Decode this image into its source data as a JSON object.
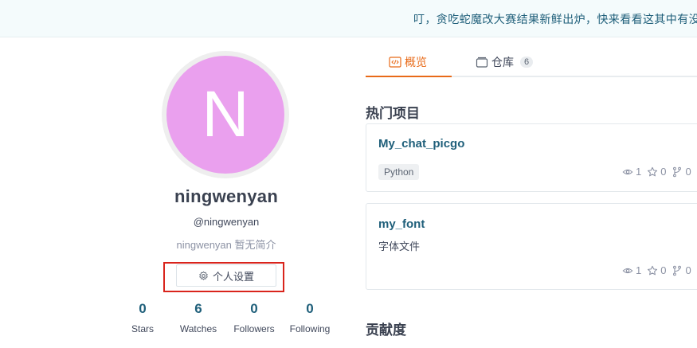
{
  "banner": {
    "text": "叮，贪吃蛇魔改大赛结果新鲜出炉，快来看看这其中有没有"
  },
  "profile": {
    "avatar_letter": "N",
    "avatar_color": "#eaa0ee",
    "display_name": "ningwenyan",
    "handle": "@ningwenyan",
    "bio": "ningwenyan 暂无简介",
    "settings_label": "个人设置"
  },
  "stats": [
    {
      "value": "0",
      "label": "Stars"
    },
    {
      "value": "6",
      "label": "Watches"
    },
    {
      "value": "0",
      "label": "Followers"
    },
    {
      "value": "0",
      "label": "Following"
    }
  ],
  "tabs": {
    "overview": "概览",
    "repos": "仓库",
    "repos_count": "6"
  },
  "hot_projects": {
    "title": "热门项目",
    "items": [
      {
        "name": "My_chat_picgo",
        "language": "Python",
        "watch": "1",
        "star": "0",
        "fork": "0"
      },
      {
        "name": "my_font",
        "description": "字体文件",
        "watch": "1",
        "star": "0",
        "fork": "0"
      }
    ]
  },
  "contribution": {
    "title": "贡献度"
  },
  "colors": {
    "accent": "#e86a18",
    "link": "#1f5f7a",
    "highlight": "#d9241c"
  }
}
